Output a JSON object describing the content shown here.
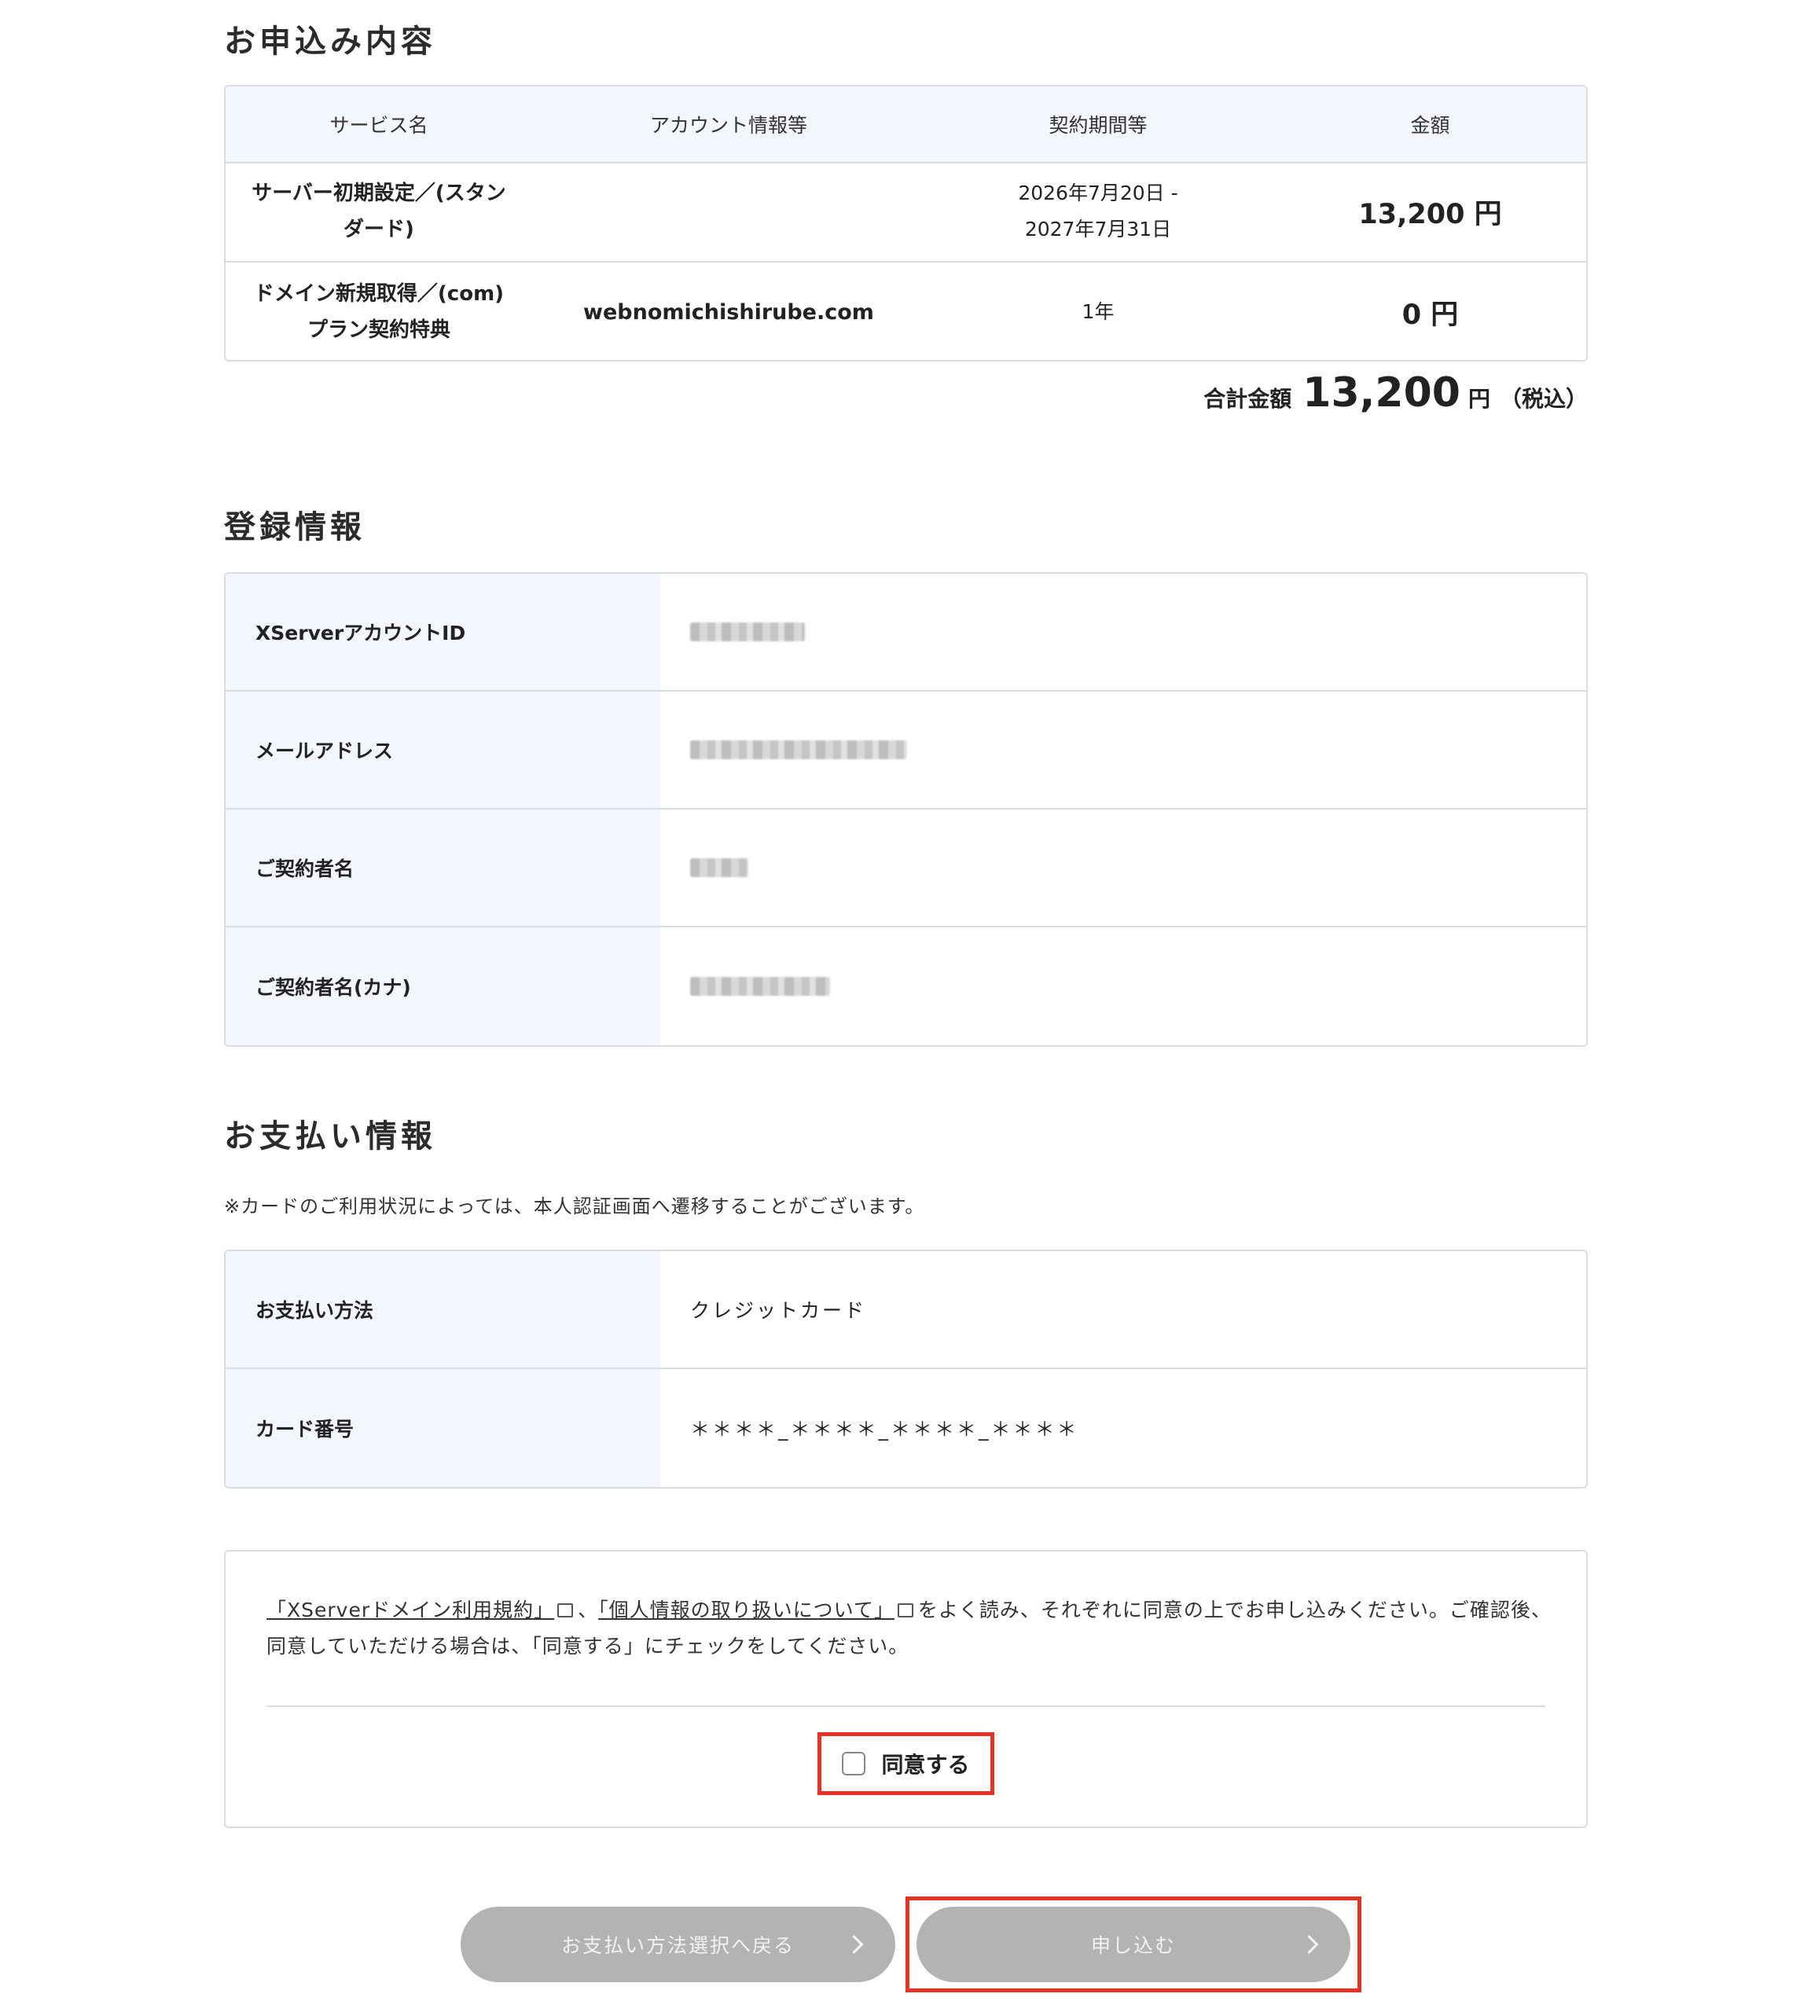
{
  "order": {
    "heading": "お申込み内容",
    "columns": [
      "サービス名",
      "アカウント情報等",
      "契約期間等",
      "金額"
    ],
    "rows": [
      {
        "service_line1": "サーバー初期設定／(スタン",
        "service_line2": "ダード)",
        "account": "",
        "period_line1": "2026年7月20日 -",
        "period_line2": "2027年7月31日",
        "amount": "13,200 円"
      },
      {
        "service_line1": "ドメイン新規取得／(com)",
        "service_line2": "プラン契約特典",
        "account": "webnomichishirube.com",
        "period_line1": "1年",
        "period_line2": "",
        "amount": "0 円"
      }
    ],
    "total_label": "合計金額",
    "total_value": "13,200",
    "total_unit": "円",
    "total_tax": "（税込）"
  },
  "registration": {
    "heading": "登録情報",
    "rows": [
      {
        "label": "XServerアカウントID"
      },
      {
        "label": "メールアドレス"
      },
      {
        "label": "ご契約者名"
      },
      {
        "label": "ご契約者名(カナ)"
      }
    ]
  },
  "payment": {
    "heading": "お支払い情報",
    "note": "※カードのご利用状況によっては、本人認証画面へ遷移することがございます。",
    "rows": [
      {
        "label": "お支払い方法",
        "value": "クレジットカード"
      },
      {
        "label": "カード番号",
        "value": "＊＊＊＊_＊＊＊＊_＊＊＊＊_＊＊＊＊"
      }
    ]
  },
  "agreement": {
    "link1": "「XServerドメイン利用規約」",
    "sep": "、",
    "link2": "「個人情報の取り扱いについて」",
    "text_after": "をよく読み、それぞれに同意の上でお申し込みください。ご確認後、",
    "text_line2": "同意していただける場合は、「同意する」にチェックをしてください。",
    "checkbox_label": "同意する",
    "checked": false
  },
  "buttons": {
    "back": "お支払い方法選択へ戻る",
    "submit": "申し込む"
  },
  "colors": {
    "highlight": "#e53323",
    "header_bg": "#f3f7fd",
    "button_disabled": "#b3b3b3"
  }
}
